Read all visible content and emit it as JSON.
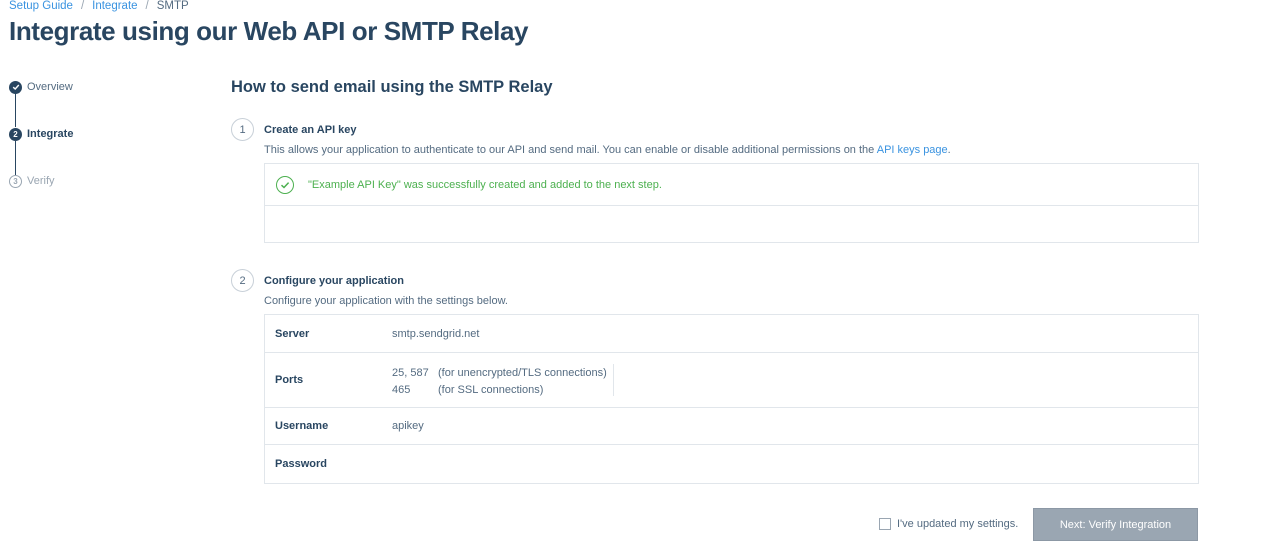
{
  "breadcrumb": {
    "items": [
      "Setup Guide",
      "Integrate"
    ],
    "current": "SMTP",
    "separator": "/"
  },
  "page_title": "Integrate using our Web API or SMTP Relay",
  "stepper": {
    "steps": [
      {
        "label": "Overview",
        "number": "",
        "status": "done"
      },
      {
        "label": "Integrate",
        "number": "2",
        "status": "active"
      },
      {
        "label": "Verify",
        "number": "3",
        "status": "pending"
      }
    ]
  },
  "section_title": "How to send email using the SMTP Relay",
  "step1": {
    "number": "1",
    "title": "Create an API key",
    "description": "This allows your application to authenticate to our API and send mail. You can enable or disable additional permissions on the",
    "link_text": "API keys page",
    "link_suffix": ".",
    "success_message": "\"Example API Key\" was successfully created and added to the next step."
  },
  "step2": {
    "number": "2",
    "title": "Configure your application",
    "description": "Configure your application with the settings below.",
    "settings": {
      "server_label": "Server",
      "server_value": "smtp.sendgrid.net",
      "ports_label": "Ports",
      "ports": [
        {
          "value": "25, 587",
          "note": "(for unencrypted/TLS connections)"
        },
        {
          "value": "465",
          "note": "(for SSL connections)"
        }
      ],
      "username_label": "Username",
      "username_value": "apikey",
      "password_label": "Password",
      "password_value": ""
    }
  },
  "confirm": {
    "label": "I've updated my settings.",
    "checked": false
  },
  "next_button": "Next: Verify Integration",
  "colors": {
    "primary": "#294661",
    "link": "#3a93e0",
    "success": "#4cb04f",
    "muted": "#9aa6b2",
    "border": "#e1e6eb"
  }
}
